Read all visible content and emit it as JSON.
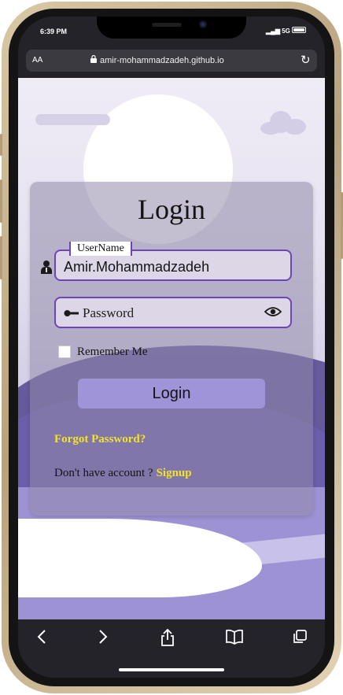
{
  "status_bar": {
    "time": "6:39 PM",
    "signal": "5G"
  },
  "browser": {
    "text_size_label": "AA",
    "url": "amir-mohammadzadeh.github.io"
  },
  "login_form": {
    "title": "Login",
    "username_legend": "UserName",
    "username_value": "Amir.Mohammadzadeh",
    "password_placeholder": "Password",
    "remember_label": "Remember Me",
    "login_button": "Login",
    "forgot_link": "Forgot Password?",
    "no_account_text": "Don't have account ?",
    "signup_link": "Signup"
  },
  "icons": [
    "user-icon",
    "key-icon",
    "eye-icon",
    "lock-icon",
    "reload-icon",
    "back-icon",
    "forward-icon",
    "share-icon",
    "bookmarks-icon",
    "tabs-icon"
  ],
  "colors": {
    "accent": "#6d45b8",
    "button": "#9f94d8",
    "link": "#f2e32a"
  }
}
